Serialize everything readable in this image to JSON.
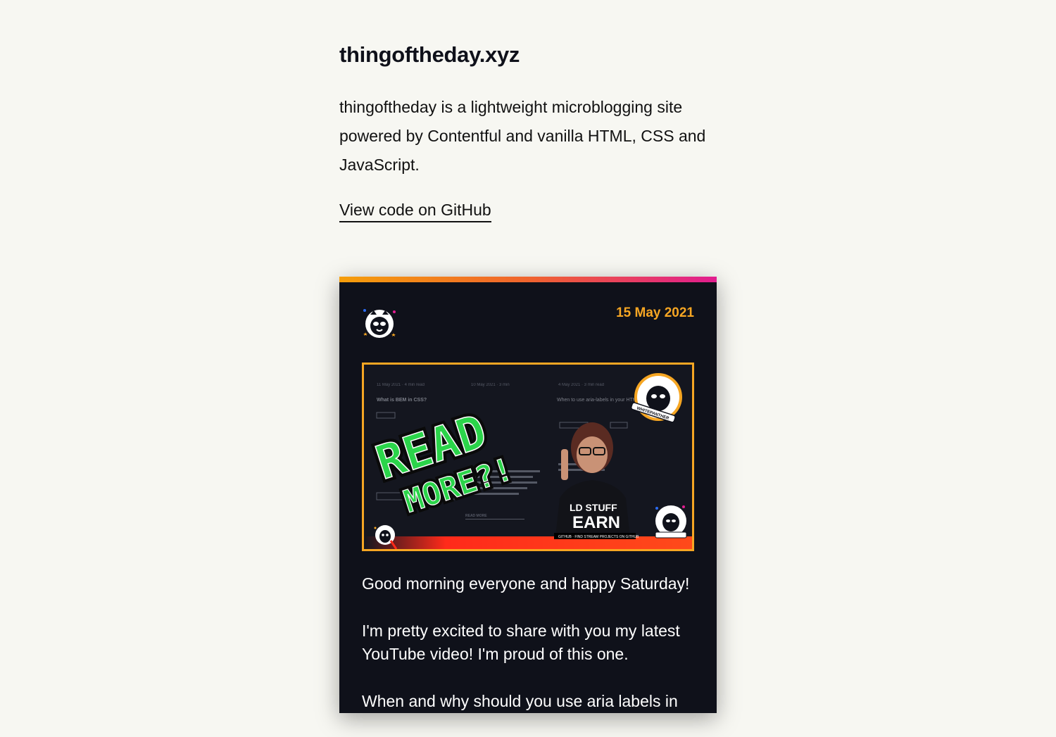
{
  "site": {
    "title": "thingoftheday.xyz",
    "description": "thingoftheday is a lightweight microblogging site powered by Contentful and vanilla HTML, CSS and JavaScript.",
    "github_link": "View code on GitHub"
  },
  "post": {
    "date": "15 May 2021",
    "avatar_icon": "panther-icon",
    "thumbnail": {
      "headline_line1": "READ",
      "headline_line2": "MORE?!",
      "shirt_text_line1": "LD STUFF",
      "shirt_text_line2": "EARN",
      "bg_meta_1": "11 May 2021 · 4 min read",
      "bg_meta_2": "10 May 2021 · 3 min",
      "bg_meta_3": "4 May 2021 · 3 min read",
      "bg_title_1": "What is BEM in CSS?",
      "bg_title_3": "When to use aria-labels in your HTML",
      "bg_read_more": "READ MORE",
      "banner_text": "GITHUB · FIND STREAM PROJECTS ON GITHUB",
      "badge_text": "WHITEPANTHER"
    },
    "paragraphs": [
      "Good morning everyone and happy Saturday!",
      "I'm pretty excited to share with you my latest YouTube video! I'm proud of this one.",
      "When and why should you use aria labels in"
    ]
  },
  "colors": {
    "page_bg": "#f7f7f2",
    "card_bg": "#0f111a",
    "accent": "#f6a623",
    "gradient_start": "#f59e0b",
    "gradient_end": "#e11d8f",
    "headline_green": "#2bd44a"
  }
}
